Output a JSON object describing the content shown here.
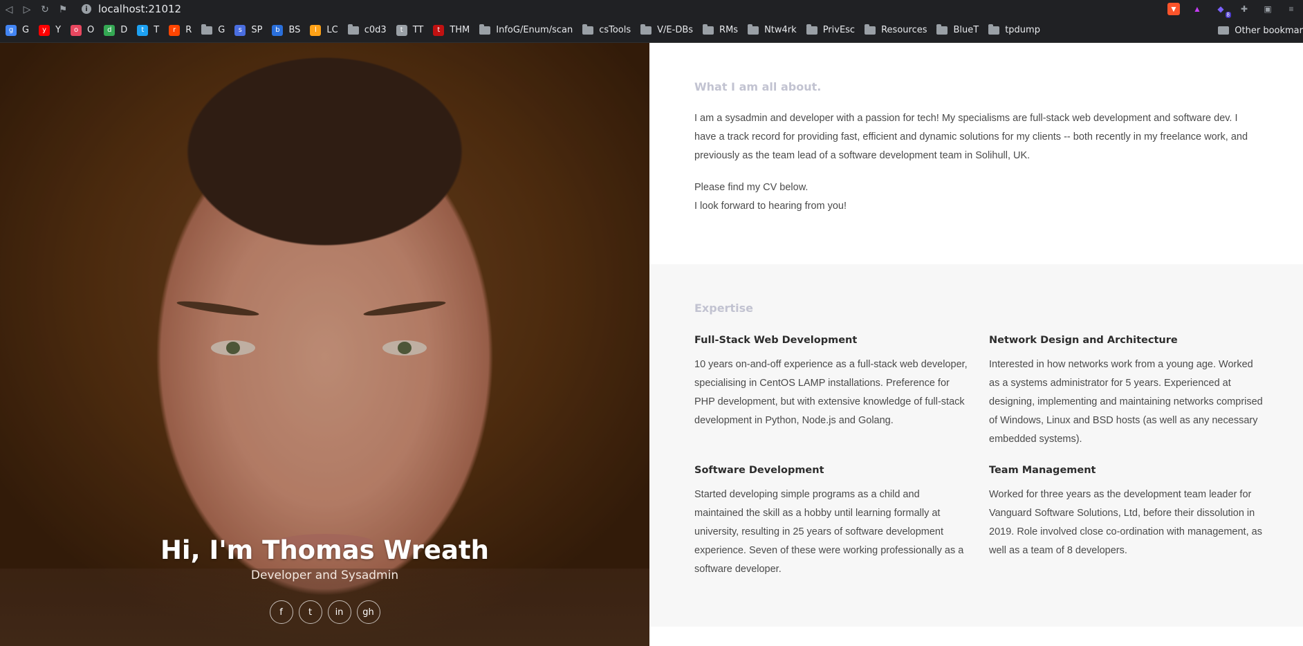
{
  "browser": {
    "url": "localhost:21012",
    "bookmarks": [
      {
        "label": "G",
        "icon": "google-icon",
        "color": "#4285f4"
      },
      {
        "label": "Y",
        "icon": "youtube-icon",
        "color": "#ff0000"
      },
      {
        "label": "O",
        "icon": "flower-icon",
        "color": "#e8475f"
      },
      {
        "label": "D",
        "icon": "drive-icon",
        "color": "#34a853"
      },
      {
        "label": "T",
        "icon": "twitter-icon",
        "color": "#1da1f2"
      },
      {
        "label": "R",
        "icon": "reddit-icon",
        "color": "#ff4500"
      },
      {
        "label": "G",
        "icon": "folder-icon",
        "color": "#9aa0a6"
      },
      {
        "label": "SP",
        "icon": "search-icon",
        "color": "#4a6ee0"
      },
      {
        "label": "BS",
        "icon": "bs-icon",
        "color": "#2a6fdb"
      },
      {
        "label": "LC",
        "icon": "lc-icon",
        "color": "#ffa116"
      },
      {
        "label": "c0d3",
        "icon": "folder-icon",
        "color": "#9aa0a6"
      },
      {
        "label": "TT",
        "icon": "globe-icon",
        "color": "#9aa0a6"
      },
      {
        "label": "THM",
        "icon": "thm-icon",
        "color": "#c11111"
      },
      {
        "label": "InfoG/Enum/scan",
        "icon": "folder-icon",
        "color": "#9aa0a6"
      },
      {
        "label": "csTools",
        "icon": "folder-icon",
        "color": "#9aa0a6"
      },
      {
        "label": "V/E-DBs",
        "icon": "folder-icon",
        "color": "#9aa0a6"
      },
      {
        "label": "RMs",
        "icon": "folder-icon",
        "color": "#9aa0a6"
      },
      {
        "label": "Ntw4rk",
        "icon": "folder-icon",
        "color": "#9aa0a6"
      },
      {
        "label": "PrivEsc",
        "icon": "folder-icon",
        "color": "#9aa0a6"
      },
      {
        "label": "Resources",
        "icon": "folder-icon",
        "color": "#9aa0a6"
      },
      {
        "label": "BlueT",
        "icon": "folder-icon",
        "color": "#9aa0a6"
      },
      {
        "label": "tpdump",
        "icon": "folder-icon",
        "color": "#9aa0a6"
      }
    ],
    "other_bookmarks": "Other bookmar",
    "extension_badge": "8"
  },
  "hero": {
    "title": "Hi, I'm Thomas Wreath",
    "subtitle": "Developer and Sysadmin",
    "socials": [
      {
        "name": "facebook-icon",
        "glyph": "f"
      },
      {
        "name": "twitter-icon",
        "glyph": "t"
      },
      {
        "name": "linkedin-icon",
        "glyph": "in"
      },
      {
        "name": "github-icon",
        "glyph": "gh"
      }
    ]
  },
  "about": {
    "title": "What I am all about.",
    "para1": "I am a sysadmin and developer with a passion for tech! My specialisms are full-stack web development and software dev. I have a track record for providing fast, efficient and dynamic solutions for my clients -- both recently in my freelance work, and previously as the team lead of a software development team in Solihull, UK.",
    "para2_line1": "Please find my CV below.",
    "para2_line2": "I look forward to hearing from you!"
  },
  "expertise": {
    "title": "Expertise",
    "items": [
      {
        "title": "Full-Stack Web Development",
        "body": "10 years on-and-off experience as a full-stack web developer, specialising in CentOS LAMP installations. Preference for PHP development, but with extensive knowledge of full-stack development in Python, Node.js and Golang."
      },
      {
        "title": "Network Design and Architecture",
        "body": "Interested in how networks work from a young age. Worked as a systems administrator for 5 years. Experienced at designing, implementing and maintaining networks comprised of Windows, Linux and BSD hosts (as well as any necessary embedded systems)."
      },
      {
        "title": "Software Development",
        "body": "Started developing simple programs as a child and maintained the skill as a hobby until learning formally at university, resulting in 25 years of software development experience. Seven of these were working professionally as a software developer."
      },
      {
        "title": "Team Management",
        "body": "Worked for three years as the development team leader for Vanguard Software Solutions, Ltd, before their dissolution in 2019. Role involved close co-ordination with management, as well as a team of 8 developers."
      }
    ]
  }
}
